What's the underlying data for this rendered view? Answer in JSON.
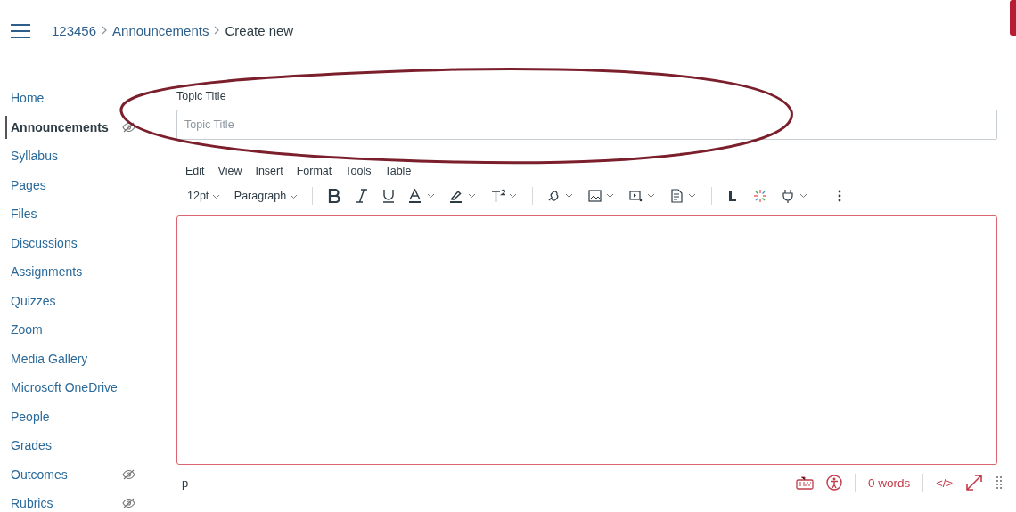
{
  "breadcrumb": [
    {
      "label": "123456",
      "kind": "link"
    },
    {
      "label": "Announcements",
      "kind": "link"
    },
    {
      "label": "Create new",
      "kind": "current"
    }
  ],
  "sidebar": {
    "items": [
      {
        "label": "Home",
        "selected": false,
        "hidden": false
      },
      {
        "label": "Announcements",
        "selected": true,
        "hidden": true
      },
      {
        "label": "Syllabus",
        "selected": false,
        "hidden": false
      },
      {
        "label": "Pages",
        "selected": false,
        "hidden": false
      },
      {
        "label": "Files",
        "selected": false,
        "hidden": false
      },
      {
        "label": "Discussions",
        "selected": false,
        "hidden": false
      },
      {
        "label": "Assignments",
        "selected": false,
        "hidden": false
      },
      {
        "label": "Quizzes",
        "selected": false,
        "hidden": false
      },
      {
        "label": "Zoom",
        "selected": false,
        "hidden": false
      },
      {
        "label": "Media Gallery",
        "selected": false,
        "hidden": false
      },
      {
        "label": "Microsoft OneDrive",
        "selected": false,
        "hidden": false
      },
      {
        "label": "People",
        "selected": false,
        "hidden": false
      },
      {
        "label": "Grades",
        "selected": false,
        "hidden": false
      },
      {
        "label": "Outcomes",
        "selected": false,
        "hidden": true
      },
      {
        "label": "Rubrics",
        "selected": false,
        "hidden": true
      }
    ]
  },
  "topic": {
    "label": "Topic Title",
    "placeholder": "Topic Title"
  },
  "editor": {
    "menu": [
      "Edit",
      "View",
      "Insert",
      "Format",
      "Tools",
      "Table"
    ],
    "font_size": "12pt",
    "block_format": "Paragraph",
    "status_bar": {
      "path": "p",
      "word_count": "0 words",
      "code_toggle": "</>"
    }
  }
}
